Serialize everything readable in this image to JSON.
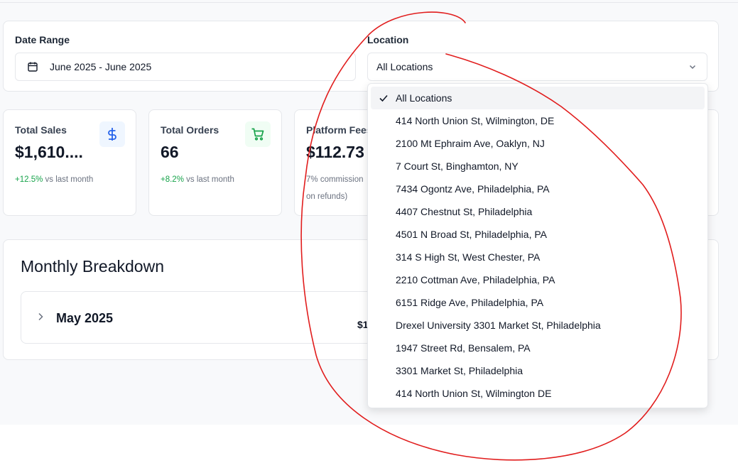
{
  "filters": {
    "date_label": "Date Range",
    "date_value": "June 2025 - June 2025",
    "location_label": "Location",
    "location_value": "All Locations"
  },
  "stats": [
    {
      "title": "Total Sales",
      "value": "$1,610....",
      "change": "+12.5%",
      "change_suffix": " vs last month",
      "icon": "dollar-icon",
      "color": "#2563eb"
    },
    {
      "title": "Total Orders",
      "value": "66",
      "change": "+8.2%",
      "change_suffix": " vs last month",
      "icon": "cart-icon",
      "color": "#16a34a"
    },
    {
      "title": "Platform Fees",
      "value": "$112.73",
      "note_line1": "7% commission",
      "note_line2": "on refunds)"
    }
  ],
  "breakdown": {
    "heading": "Monthly Breakdown",
    "rows": [
      {
        "month": "May 2025",
        "value_partial": "$1"
      }
    ]
  },
  "location_options": [
    "All Locations",
    "414 North Union St, Wilmington, DE",
    "2100 Mt Ephraim Ave, Oaklyn, NJ",
    "7 Court St, Binghamton, NY",
    "7434 Ogontz Ave, Philadelphia, PA",
    "4407 Chestnut St, Philadelphia",
    "4501 N Broad St, Philadelphia, PA",
    "314 S High St, West Chester, PA",
    "2210 Cottman Ave, Philadelphia, PA",
    "6151 Ridge Ave, Philadelphia, PA",
    "Drexel University 3301 Market St, Philadelphia",
    "1947 Street Rd, Bensalem, PA",
    "3301 Market St, Philadelphia",
    "414 North Union St, Wilmington DE"
  ],
  "colors": {
    "accent_blue": "#2563eb",
    "accent_green": "#16a34a",
    "annotation_red": "#e11d1d"
  }
}
